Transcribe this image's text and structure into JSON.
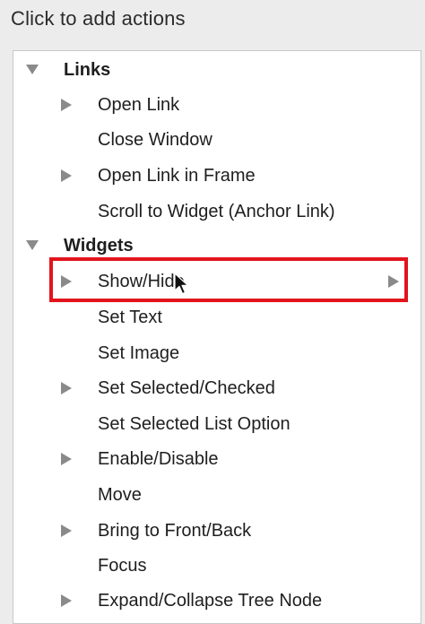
{
  "header": {
    "title": "Click to add actions"
  },
  "tree": {
    "groups": [
      {
        "label": "Links",
        "items": [
          {
            "label": "Open Link",
            "expandable": true
          },
          {
            "label": "Close Window",
            "expandable": false
          },
          {
            "label": "Open Link in Frame",
            "expandable": true
          },
          {
            "label": "Scroll to Widget (Anchor Link)",
            "expandable": false
          }
        ]
      },
      {
        "label": "Widgets",
        "items": [
          {
            "label": "Show/Hide",
            "expandable": true,
            "selected": true,
            "submenu": true
          },
          {
            "label": "Set Text",
            "expandable": false
          },
          {
            "label": "Set Image",
            "expandable": false
          },
          {
            "label": "Set Selected/Checked",
            "expandable": true
          },
          {
            "label": "Set Selected List Option",
            "expandable": false
          },
          {
            "label": "Enable/Disable",
            "expandable": true
          },
          {
            "label": "Move",
            "expandable": false
          },
          {
            "label": "Bring to Front/Back",
            "expandable": true
          },
          {
            "label": "Focus",
            "expandable": false
          },
          {
            "label": "Expand/Collapse Tree Node",
            "expandable": true
          }
        ]
      }
    ]
  },
  "colors": {
    "highlight": "#e2141c",
    "triangle": "#8a8a8a",
    "panel_background": "#ffffff",
    "page_background": "#ececec"
  }
}
